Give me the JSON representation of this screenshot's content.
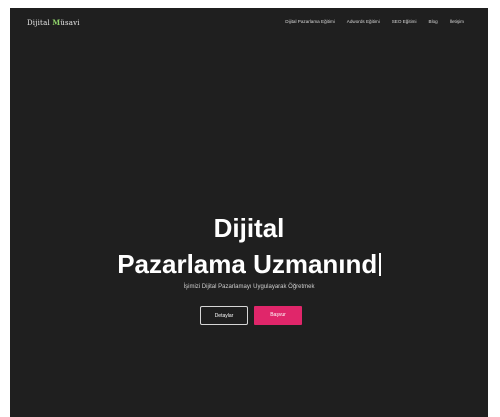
{
  "nav": {
    "logo": {
      "prefix": "Dijital ",
      "accent": "M",
      "suffix": "üsavi"
    },
    "menu": [
      {
        "label": "Dijital Pazarlama Eğitimi"
      },
      {
        "label": "Adwords Eğitimi"
      },
      {
        "label": "SEO Eğitimi"
      },
      {
        "label": "Blog"
      },
      {
        "label": "İletişim"
      }
    ]
  },
  "hero": {
    "title_line1": "Dijital",
    "title_line2": "Pazarlama Uzmanınd",
    "subtitle": "İşimizi Dijital Pazarlamayı Uygulayarak Öğretmek",
    "buttons": {
      "secondary": "Detaylar",
      "primary": "Başvur"
    }
  },
  "colors": {
    "background": "#1f1f1f",
    "primary_button": "#e0266a",
    "logo_accent": "#8fd46a"
  }
}
